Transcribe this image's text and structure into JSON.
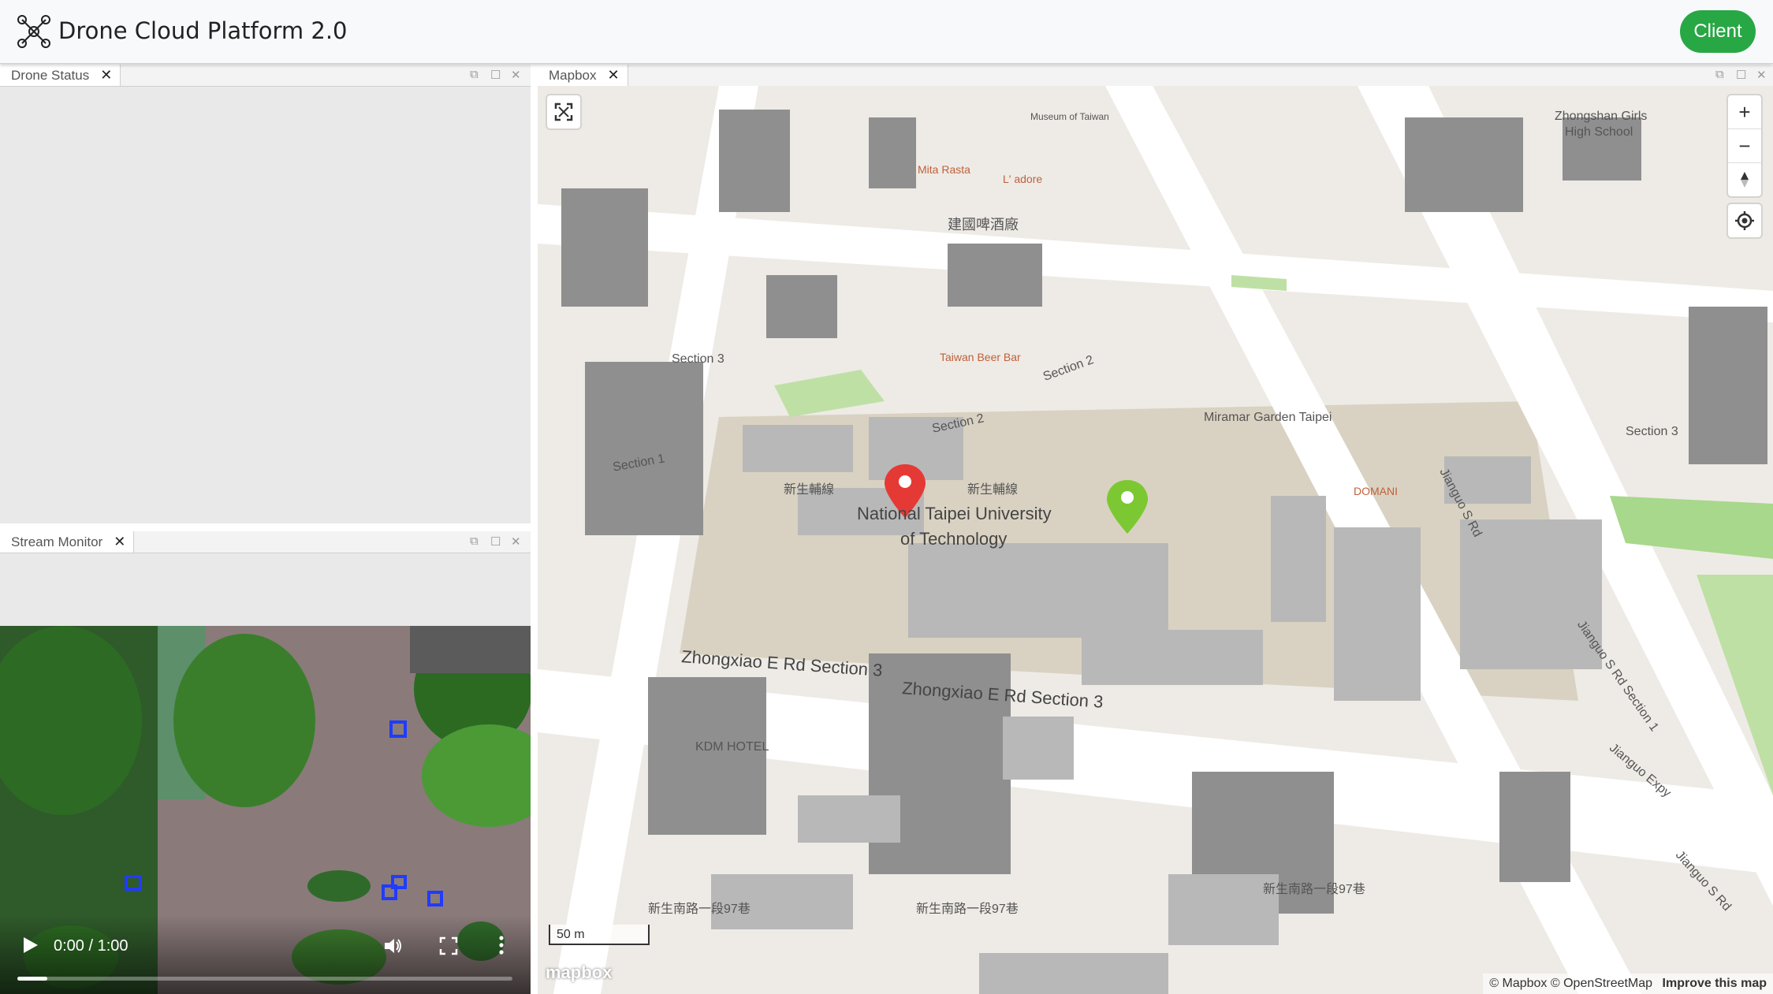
{
  "header": {
    "title": "Drone Cloud Platform 2.0",
    "client_label": "Client",
    "accent": "#28a745"
  },
  "panels": {
    "status": {
      "tab_label": "Drone Status",
      "close": "✕"
    },
    "stream": {
      "tab_label": "Stream Monitor",
      "close": "✕"
    },
    "map": {
      "tab_label": "Mapbox",
      "close": "✕"
    }
  },
  "video": {
    "time": "0:00 / 1:00",
    "progress": 0.06
  },
  "map": {
    "zoom_in": "+",
    "zoom_out": "−",
    "scale": "50 m",
    "logo": "mapbox",
    "attribution": "© Mapbox © OpenStreetMap",
    "improve": "Improve this map",
    "labels": {
      "ntut": "National Taipei University",
      "ntut2": "of Technology",
      "zhongxiao1": "Zhongxiao E Rd Section 3",
      "zhongxiao2": "Zhongxiao E Rd Section 3",
      "kdm": "KDM HOTEL",
      "miramar": "Miramar Garden Taipei",
      "domani": "DOMANI",
      "taiwan_beer": "Taiwan Beer Bar",
      "jianguo1": "Jianguo Expy",
      "jianguo2": "Jianguo S Rd",
      "jianguo3": "Jianguo S Rd Section 1",
      "jianguo4": "Jianguo Expy",
      "section1": "Section 1",
      "section2": "Section 2",
      "section3": "Section 3",
      "section3b": "Section 3",
      "section2b": "Section 2",
      "xinsheng1": "新生南路一段97巷",
      "xinsheng2": "新生南路一段97巷",
      "xinsheng3": "新生南路一段97巷",
      "xinsheng_n1": "新生輔線",
      "xinsheng_n2": "新生輔線",
      "zhongshan": "Zhongshan Girls",
      "zhongshan2": "High School",
      "museum": "Museum of Taiwan",
      "ladore": "L' adore",
      "beer": "建國啤酒廠",
      "mitarasta": "Mita Rasta"
    }
  }
}
